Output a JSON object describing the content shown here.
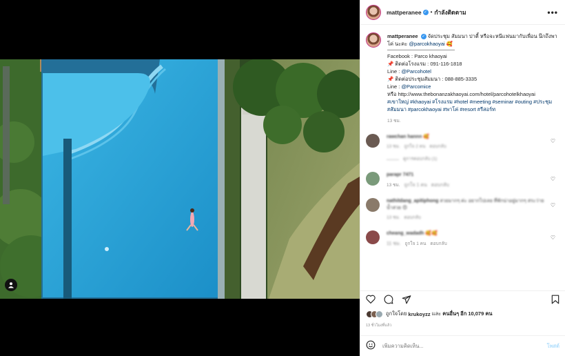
{
  "header": {
    "username": "mattperanee",
    "verified_icon": "verified-badge-icon",
    "separator": "•",
    "follow_status": "กำลังติดตาม",
    "more_icon": "•••"
  },
  "caption": {
    "username": "mattperanee",
    "text": "จัดประชุม สัมมนา ปาตี้ หรือจะหนีแฟนมากับเพื่อน นึกถึงพาโค่ นะคะ",
    "mention": "@parcokhaoyai",
    "emoji": "🥰",
    "lines": [
      "Facebook : Parco khaoyai",
      "📌 ติดต่อโรงแรม : 091-116-1818",
      "Line : @Parcohotel",
      "📌 ติดต่อประชุมสัมมนา : 088-885-3335",
      "Line : @Parcomice"
    ],
    "link_prefix": "หรือ",
    "url": "http://www.thebonanzakhaoyai.com/hotel/parcohotelkhaoyai",
    "hashtags": "#เขาใหญ่ #khaoyai #โรงแรม #hotel #meeting #seminar #outing #ประชุม #สัมมนา #parcokhaoyai #พาโค่ #resort #รีสอร์ท",
    "time": "13 ชม."
  },
  "comments": [
    {
      "name": "rawchan hannn",
      "text": "🥰",
      "time": "13 ชม.",
      "likes": "ถูกใจ 2 คน",
      "reply": "ตอบกลับ",
      "replies": "ดูการตอบกลับ (1)",
      "color": "#6a5a52"
    },
    {
      "name": "parapr 7471",
      "text": "",
      "time": "13 ชม.",
      "likes": "ถูกใจ 1 คน",
      "reply": "ตอบกลับ",
      "replies": "",
      "color": "#7a9a7a"
    },
    {
      "name": "nathitdang_apitiphong",
      "text": "สวยมากๆ ค่ะ อยากไปเลย ที่พักน่าอยู่มากๆ สระว่ายน้ำสวย 😍",
      "time": "13 ชม.",
      "likes": "",
      "reply": "ตอบกลับ",
      "replies": "",
      "color": "#8a7a6a"
    },
    {
      "name": "cheang_wadadh",
      "text": "🥰🥰",
      "time": "11 ชม.",
      "likes": "ถูกใจ 1 คน",
      "reply": "ตอบกลับ",
      "replies": "",
      "color": "#8a4a4a"
    }
  ],
  "actions": {
    "like_icon": "heart-icon",
    "comment_icon": "comment-icon",
    "share_icon": "share-icon",
    "save_icon": "bookmark-icon"
  },
  "likes": {
    "prefix": "ถูกใจโดย",
    "user": "krukoyzz",
    "and": "และ",
    "others": "คนอื่นๆ อีก 10,079 คน"
  },
  "post_time": "13 ชั่วโมงที่แล้ว",
  "comment_input": {
    "placeholder": "เพิ่มความคิดเห็น...",
    "post_label": "โพสต์"
  },
  "colors": {
    "accent": "#3897f0",
    "link": "#00376b",
    "pool": "#1ea1d6"
  }
}
